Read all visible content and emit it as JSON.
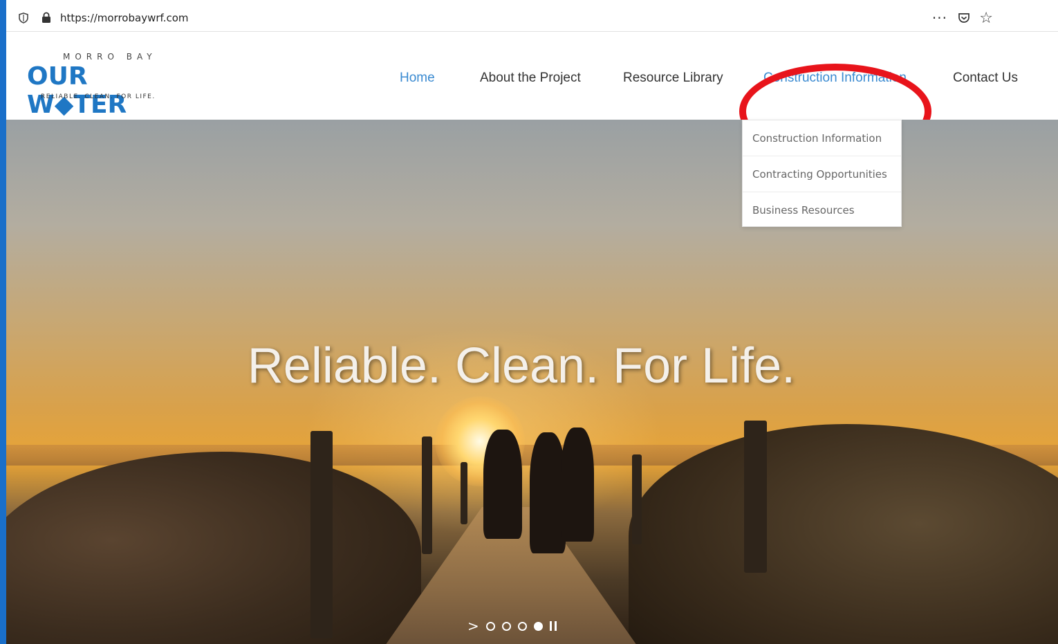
{
  "browser": {
    "url": "https://morrobaywrf.com",
    "more_glyph": "···",
    "star_glyph": "☆"
  },
  "logo": {
    "top": "MORRO BAY",
    "main": "OUR W◆TER",
    "sub": "RELIABLE. CLEAN. FOR LIFE."
  },
  "nav": {
    "home": "Home",
    "about": "About the Project",
    "resource": "Resource Library",
    "construction": "Construction Information",
    "contact": "Contact Us"
  },
  "dropdown": {
    "items": [
      "Construction Information",
      "Contracting Opportunities",
      "Business Resources"
    ]
  },
  "hero": {
    "title": "Reliable. Clean. For Life.",
    "next_glyph": ">",
    "slides_total": 4,
    "active_slide": 4
  },
  "colors": {
    "accent": "#3a8ad1",
    "highlight": "#e8141b",
    "frame": "#1a6fc9"
  }
}
